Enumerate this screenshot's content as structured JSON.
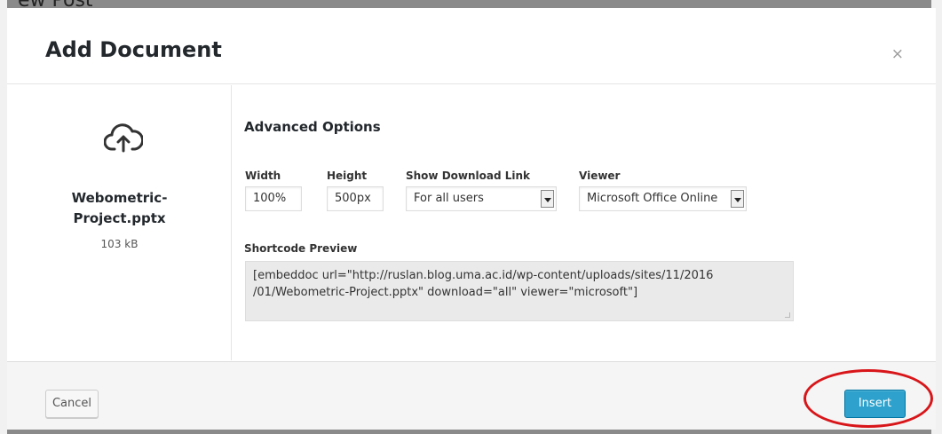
{
  "background": {
    "title_fragment": "ew Post"
  },
  "modal": {
    "title": "Add Document",
    "close_symbol": "×",
    "file": {
      "icon": "cloud-upload-icon",
      "name_line1": "Webometric-",
      "name_line2": "Project.pptx",
      "size": "103 kB"
    },
    "options": {
      "section_title": "Advanced Options",
      "width": {
        "label": "Width",
        "value": "100%"
      },
      "height": {
        "label": "Height",
        "value": "500px"
      },
      "download": {
        "label": "Show Download Link",
        "selected": "For all users"
      },
      "viewer": {
        "label": "Viewer",
        "selected": "Microsoft Office Online"
      },
      "preview": {
        "label": "Shortcode Preview",
        "line1": "[embeddoc url=\"http://ruslan.blog.uma.ac.id/wp-content/uploads/sites/11/2016",
        "line2": "/01/Webometric-Project.pptx\" download=\"all\" viewer=\"microsoft\"]"
      }
    },
    "footer": {
      "cancel_label": "Cancel",
      "insert_label": "Insert"
    }
  },
  "colors": {
    "primary_button": "#2ea2cc",
    "highlight_ring": "#d8161a"
  }
}
